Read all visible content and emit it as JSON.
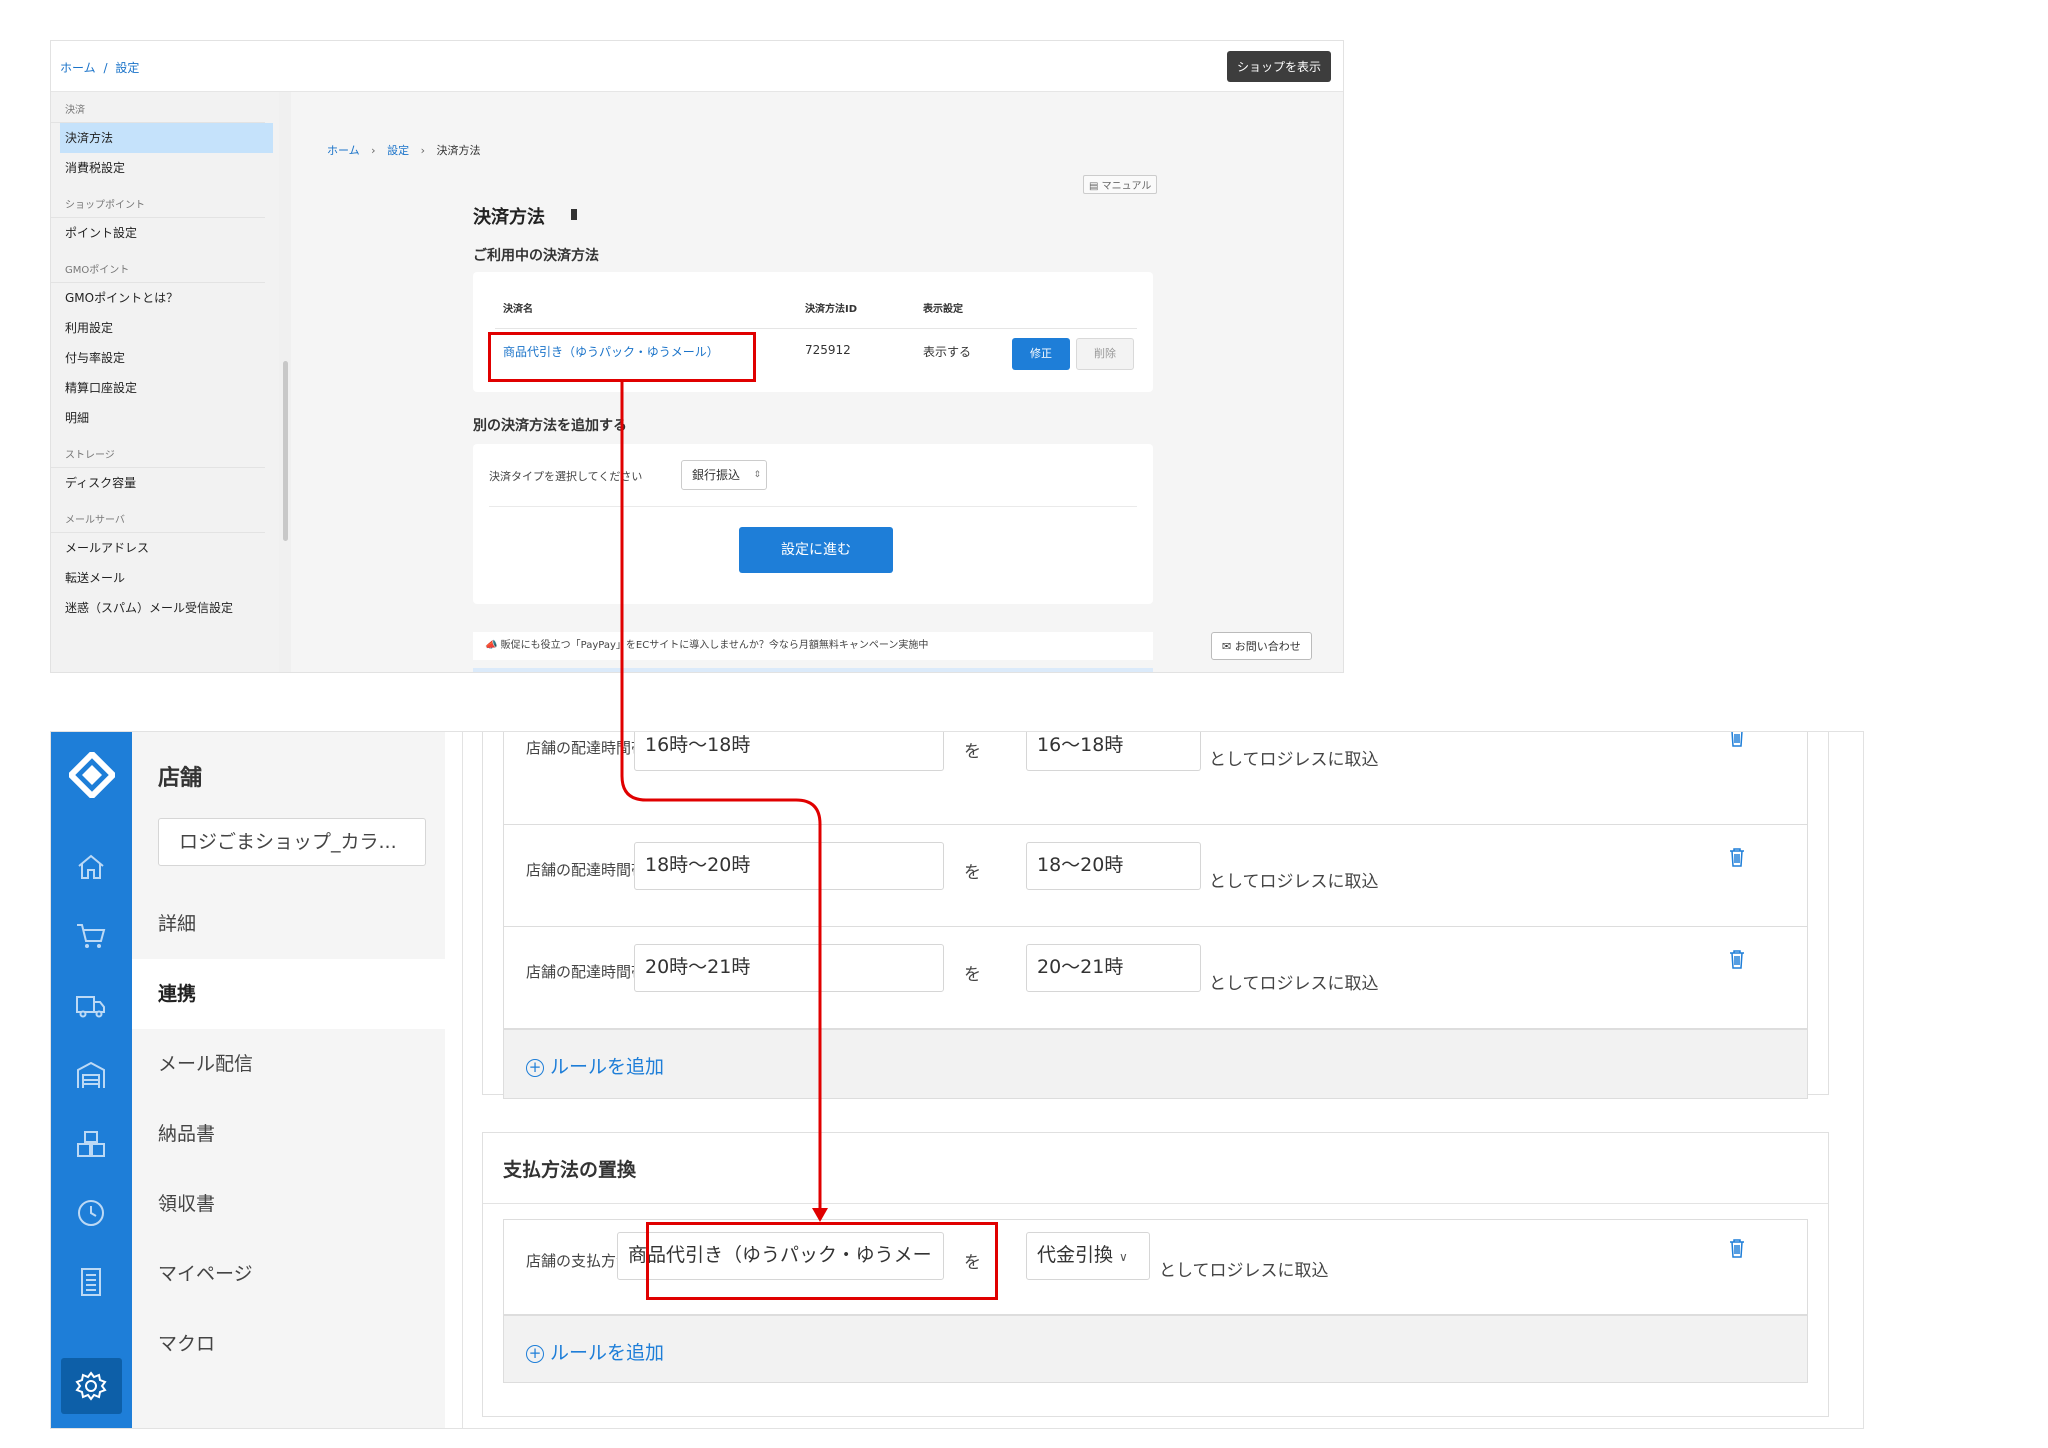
{
  "shop_admin": {
    "top_breadcrumb": [
      "ホーム",
      "設定"
    ],
    "top_breadcrumb_sep": "/",
    "show_shop_button": "ショップを表示",
    "sidebar": [
      {
        "section": "決済",
        "items": [
          {
            "label": "決済方法",
            "active": true
          },
          {
            "label": "消費税設定"
          }
        ]
      },
      {
        "section": "ショップポイント",
        "items": [
          {
            "label": "ポイント設定"
          }
        ]
      },
      {
        "section": "GMOポイント",
        "items": [
          {
            "label": "GMOポイントとは？"
          },
          {
            "label": "利用設定"
          },
          {
            "label": "付与率設定"
          },
          {
            "label": "精算口座設定"
          },
          {
            "label": "明細"
          }
        ]
      },
      {
        "section": "ストレージ",
        "items": [
          {
            "label": "ディスク容量"
          }
        ]
      },
      {
        "section": "メールサーバ",
        "items": [
          {
            "label": "メールアドレス"
          },
          {
            "label": "転送メール"
          },
          {
            "label": "迷惑（スパム）メール受信設定"
          }
        ]
      }
    ],
    "breadcrumb": {
      "home": "ホーム",
      "settings": "設定",
      "current": "決済方法",
      "arrow": "›"
    },
    "manual_button": "マニュアル",
    "page_title": "決済方法",
    "in_use": {
      "heading": "ご利用中の決済方法",
      "columns": {
        "name": "決済名",
        "id": "決済方法ID",
        "display": "表示設定"
      },
      "row": {
        "name": "商品代引き（ゆうパック・ゆうメール）",
        "id": "725912",
        "display": "表示する",
        "edit": "修正",
        "delete": "削除"
      }
    },
    "add_method": {
      "heading": "別の決済方法を追加する",
      "type_label": "決済タイプを選択してください",
      "type_value": "銀行振込",
      "select_arrow": "⇕",
      "proceed_button": "設定に進む"
    },
    "banner_text": "販促にも役立つ「PayPay」をECサイトに導入しませんか？今なら月額無料キャンペーン実施中",
    "contact_button": "お問い合わせ"
  },
  "logiless": {
    "store_title": "店舗",
    "shop_select": "ロジごまショップ_カラ...",
    "nav": [
      {
        "label": "詳細"
      },
      {
        "label": "連携",
        "active": true
      },
      {
        "label": "メール配信"
      },
      {
        "label": "納品書"
      },
      {
        "label": "領収書"
      },
      {
        "label": "マイページ"
      },
      {
        "label": "マクロ"
      }
    ],
    "delivery_rules": [
      {
        "label": "店舗の配達時間帯",
        "from": "16時～18時",
        "wo": "を",
        "to": "16～18時",
        "suffix": "としてロジレスに取込"
      },
      {
        "label": "店舗の配達時間帯",
        "from": "18時～20時",
        "wo": "を",
        "to": "18～20時",
        "suffix": "としてロジレスに取込"
      },
      {
        "label": "店舗の配達時間帯",
        "from": "20時～21時",
        "wo": "を",
        "to": "20～21時",
        "suffix": "としてロジレスに取込"
      }
    ],
    "add_rule": "ルールを追加",
    "add_rule_plus": "+",
    "payment_section": {
      "title": "支払方法の置換",
      "rule": {
        "label": "店舗の支払方法",
        "from": "商品代引き（ゆうパック・ゆうメー",
        "wo": "を",
        "to": "代金引換",
        "dropdown_arrow": "∨",
        "suffix": "としてロジレスに取込"
      }
    }
  },
  "colors": {
    "accent": "#1e7ed8",
    "highlight": "#e00000"
  }
}
